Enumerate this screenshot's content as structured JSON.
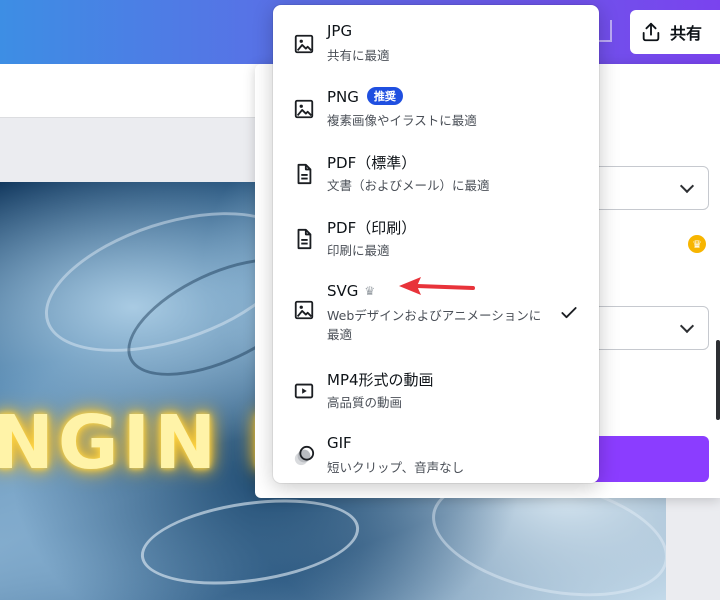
{
  "header": {
    "share_label": "共有"
  },
  "export_menu": {
    "options": [
      {
        "title": "JPG",
        "badge": "",
        "desc": "共有に最適",
        "icon": "image-icon"
      },
      {
        "title": "PNG",
        "badge": "推奨",
        "desc": "複素画像やイラストに最適",
        "icon": "image-icon"
      },
      {
        "title": "PDF（標準）",
        "badge": "",
        "desc": "文書（およびメール）に最適",
        "icon": "document-icon"
      },
      {
        "title": "PDF（印刷）",
        "badge": "",
        "desc": "印刷に最適",
        "icon": "document-icon"
      },
      {
        "title": "SVG",
        "badge": "",
        "desc": "Webデザインおよびアニメーションに最適",
        "icon": "image-icon",
        "pro": true,
        "selected": true
      },
      {
        "title": "MP4形式の動画",
        "badge": "",
        "desc": "高品質の動画",
        "icon": "video-icon"
      },
      {
        "title": "GIF",
        "badge": "",
        "desc": "短いクリップ、音声なし",
        "icon": "gif-icon"
      }
    ]
  },
  "canvas": {
    "design_text": "NGIN E"
  },
  "colors": {
    "accent": "#8b3dff",
    "badge": "#1f4fe0",
    "arrow": "#e8333a",
    "crown": "#f7b500"
  }
}
